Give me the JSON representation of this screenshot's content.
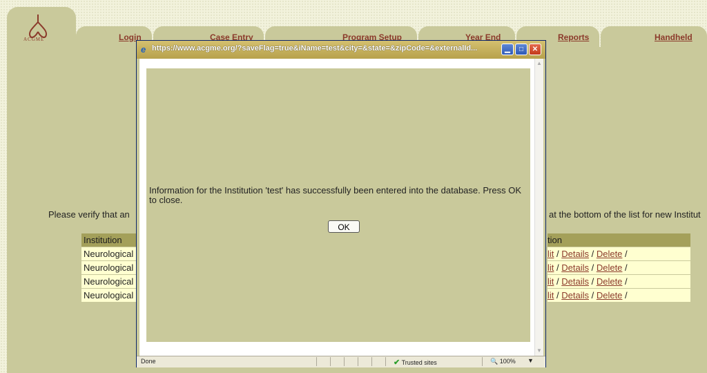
{
  "nav": {
    "logo_text": "ACGME",
    "login": "Login",
    "case_entry": "Case Entry",
    "program_setup": "Program Setup",
    "year_end": "Year End",
    "reports": "Reports",
    "handheld": "Handheld"
  },
  "page": {
    "verify_text_left": "Please verify that an",
    "verify_text_right": "at the bottom of the list for new Institut",
    "table": {
      "header_left": "Institution",
      "header_right": "tion",
      "rows": [
        {
          "institution": "Neurological",
          "edit": "lit",
          "details": "Details",
          "delete": "Delete"
        },
        {
          "institution": "Neurological",
          "edit": "lit",
          "details": "Details",
          "delete": "Delete"
        },
        {
          "institution": "Neurological",
          "edit": "lit",
          "details": "Details",
          "delete": "Delete"
        },
        {
          "institution": "Neurological",
          "edit": "lit",
          "details": "Details",
          "delete": "Delete"
        }
      ]
    }
  },
  "popup": {
    "title": "https://www.acgme.org/?saveFlag=true&iName=test&city=&state=&zipCode=&externalId...",
    "message": "Information for the Institution 'test' has successfully been entered into the database. Press OK to close.",
    "ok_label": "OK",
    "status": "Done",
    "trusted": "Trusted sites",
    "zoom": "100%"
  },
  "colors": {
    "panel": "#c9c99b",
    "table_header": "#a4a05a",
    "table_row": "#ffffd0",
    "link": "#8b3a2b"
  }
}
